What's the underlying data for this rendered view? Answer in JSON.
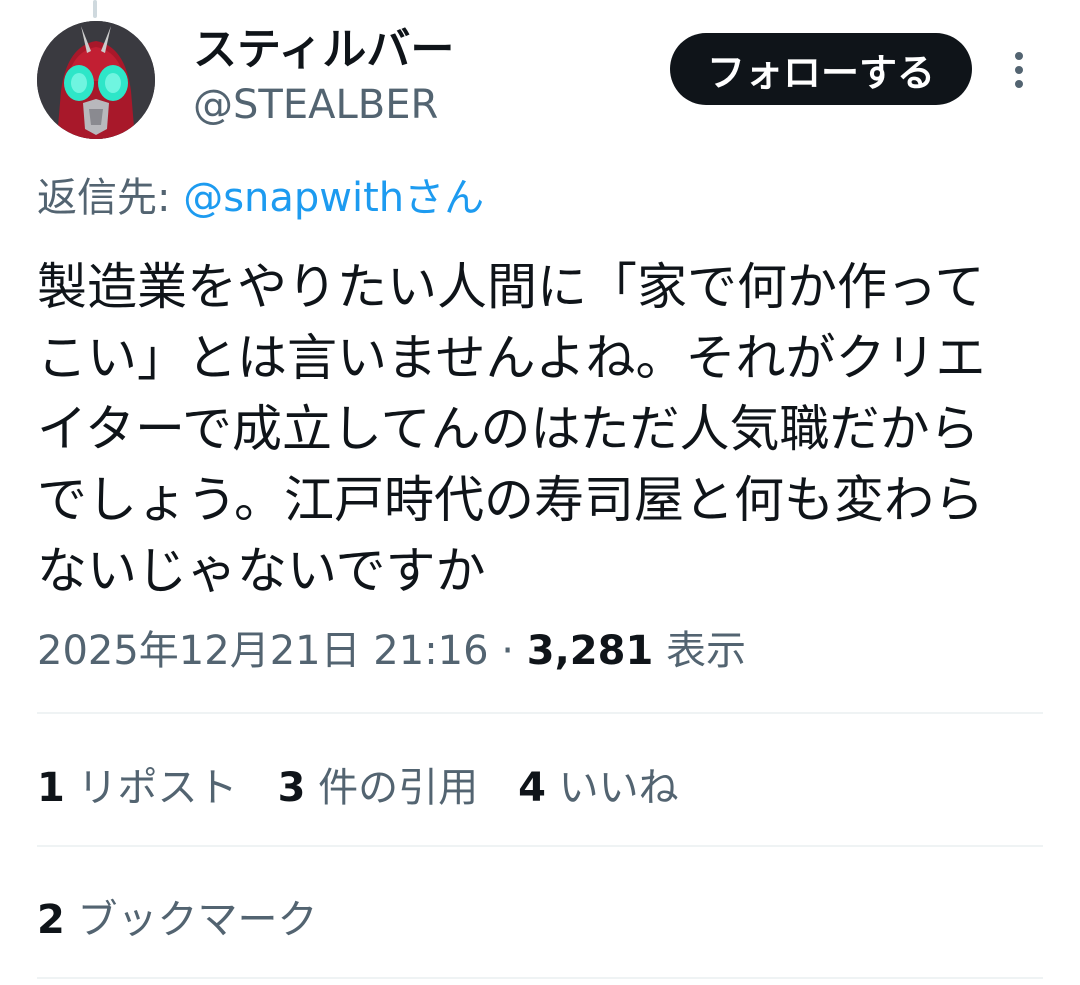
{
  "author": {
    "display_name": "スティルバー",
    "handle": "@STEALBER",
    "avatar_icon": "masked-hero-avatar"
  },
  "follow_button": {
    "label": "フォローする"
  },
  "more_icon": "more-vertical-icon",
  "reply": {
    "prefix": "返信先: ",
    "mention": "@snapwithさん"
  },
  "tweet": {
    "lines": [
      "製造業をやりたい人間に「家で何か作って",
      "こい」とは言いませんよね。それがクリエ",
      "イターで成立してんのはただ人気職だから",
      "でしょう。江戸時代の寿司屋と何も変わら",
      "ないじゃないですか"
    ]
  },
  "meta": {
    "timestamp": "2025年12月21日 21:16",
    "separator": " · ",
    "views_count": "3,281",
    "views_label": " 表示"
  },
  "stats": {
    "reposts": {
      "count": "1",
      "label": " リポスト"
    },
    "quotes": {
      "count": "3",
      "label": " 件の引用"
    },
    "likes": {
      "count": "4",
      "label": " いいね"
    },
    "bookmarks": {
      "count": "2",
      "label": " ブックマーク"
    }
  },
  "colors": {
    "text_primary": "#0f1419",
    "text_secondary": "#536471",
    "link": "#1d9bf0",
    "divider": "#eff3f4",
    "button_bg": "#0f1419"
  }
}
